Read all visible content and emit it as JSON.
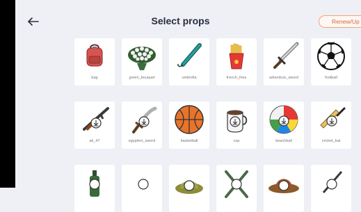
{
  "header": {
    "title": "Select props",
    "renew_label": "Renew/Up"
  },
  "props": [
    {
      "label": "bag",
      "icon": "bag-icon",
      "downloaded": true
    },
    {
      "label": "green_bouquet",
      "icon": "bouquet-icon",
      "downloaded": true
    },
    {
      "label": "umbrella",
      "icon": "umbrella-icon",
      "downloaded": true
    },
    {
      "label": "french_fries",
      "icon": "fries-icon",
      "downloaded": true
    },
    {
      "label": "adventure_sword",
      "icon": "sword-icon",
      "downloaded": true
    },
    {
      "label": "football",
      "icon": "football-icon",
      "downloaded": true
    },
    {
      "label": "ak_47",
      "icon": "rifle-icon",
      "downloaded": false
    },
    {
      "label": "egyption_sword",
      "icon": "egyptian-sword-icon",
      "downloaded": false
    },
    {
      "label": "basketball",
      "icon": "basketball-icon",
      "downloaded": true
    },
    {
      "label": "cup",
      "icon": "cup-icon",
      "downloaded": false
    },
    {
      "label": "beachball",
      "icon": "beachball-icon",
      "downloaded": false
    },
    {
      "label": "cricket_bat",
      "icon": "cricket-bat-icon",
      "downloaded": false
    },
    {
      "label": "",
      "icon": "bottle-icon",
      "downloaded": false
    },
    {
      "label": "",
      "icon": "prop-icon",
      "downloaded": false
    },
    {
      "label": "",
      "icon": "hat-icon",
      "downloaded": false
    },
    {
      "label": "",
      "icon": "crossed-swords-icon",
      "downloaded": false
    },
    {
      "label": "",
      "icon": "cowboy-hat-icon",
      "downloaded": false
    },
    {
      "label": "",
      "icon": "prop-icon",
      "downloaded": false
    }
  ]
}
